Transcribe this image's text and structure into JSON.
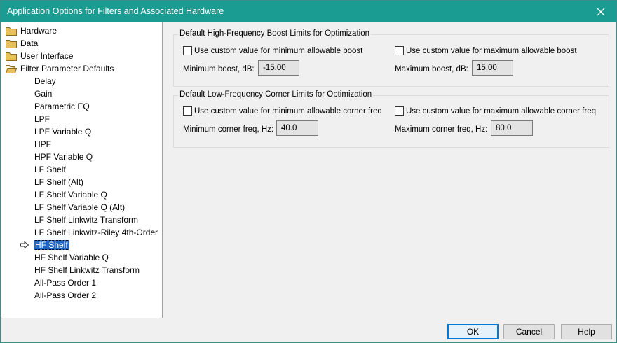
{
  "window": {
    "title": "Application Options for Filters and Associated Hardware"
  },
  "tree": {
    "folders": [
      {
        "label": "Hardware"
      },
      {
        "label": "Data"
      },
      {
        "label": "User Interface"
      },
      {
        "label": "Filter Parameter Defaults"
      }
    ],
    "items": [
      "Delay",
      "Gain",
      "Parametric EQ",
      "LPF",
      "LPF Variable Q",
      "HPF",
      "HPF Variable Q",
      "LF Shelf",
      "LF Shelf (Alt)",
      "LF Shelf Variable Q",
      "LF Shelf Variable Q (Alt)",
      "LF Shelf Linkwitz Transform",
      "LF Shelf Linkwitz-Riley 4th-Order",
      "HF Shelf",
      "HF Shelf Variable Q",
      "HF Shelf Linkwitz Transform",
      "All-Pass Order 1",
      "All-Pass Order 2"
    ],
    "selected": "HF Shelf"
  },
  "boost_group": {
    "title": "Default High-Frequency Boost Limits for Optimization",
    "min_checkbox": "Use custom value for minimum allowable boost",
    "max_checkbox": "Use custom value for maximum allowable boost",
    "min_label": "Minimum boost, dB:",
    "min_value": "-15.00",
    "max_label": "Maximum boost, dB:",
    "max_value": "15.00"
  },
  "corner_group": {
    "title": "Default Low-Frequency Corner Limits for Optimization",
    "min_checkbox": "Use custom value for minimum allowable corner freq",
    "max_checkbox": "Use custom value for maximum allowable corner freq",
    "min_label": "Minimum corner freq, Hz:",
    "min_value": "40.0",
    "max_label": "Maximum corner freq, Hz:",
    "max_value": "80.0"
  },
  "buttons": {
    "ok": "OK",
    "cancel": "Cancel",
    "help": "Help"
  },
  "colors": {
    "titlebar": "#1b9c92",
    "selection": "#1e66c8",
    "folder": "#e8c15a"
  }
}
